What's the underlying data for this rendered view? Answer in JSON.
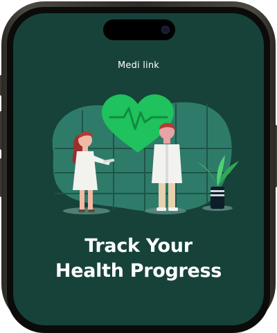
{
  "app": {
    "title": "Medi link"
  },
  "onboarding": {
    "headline_line1": "Track Your",
    "headline_line2": "Health Progress"
  },
  "colors": {
    "screen_bg": "#16423a",
    "heart": "#1fc25c",
    "blob": "#2f7b69",
    "text": "#ffffff"
  },
  "icons": {
    "heart": "heart-pulse-icon"
  }
}
